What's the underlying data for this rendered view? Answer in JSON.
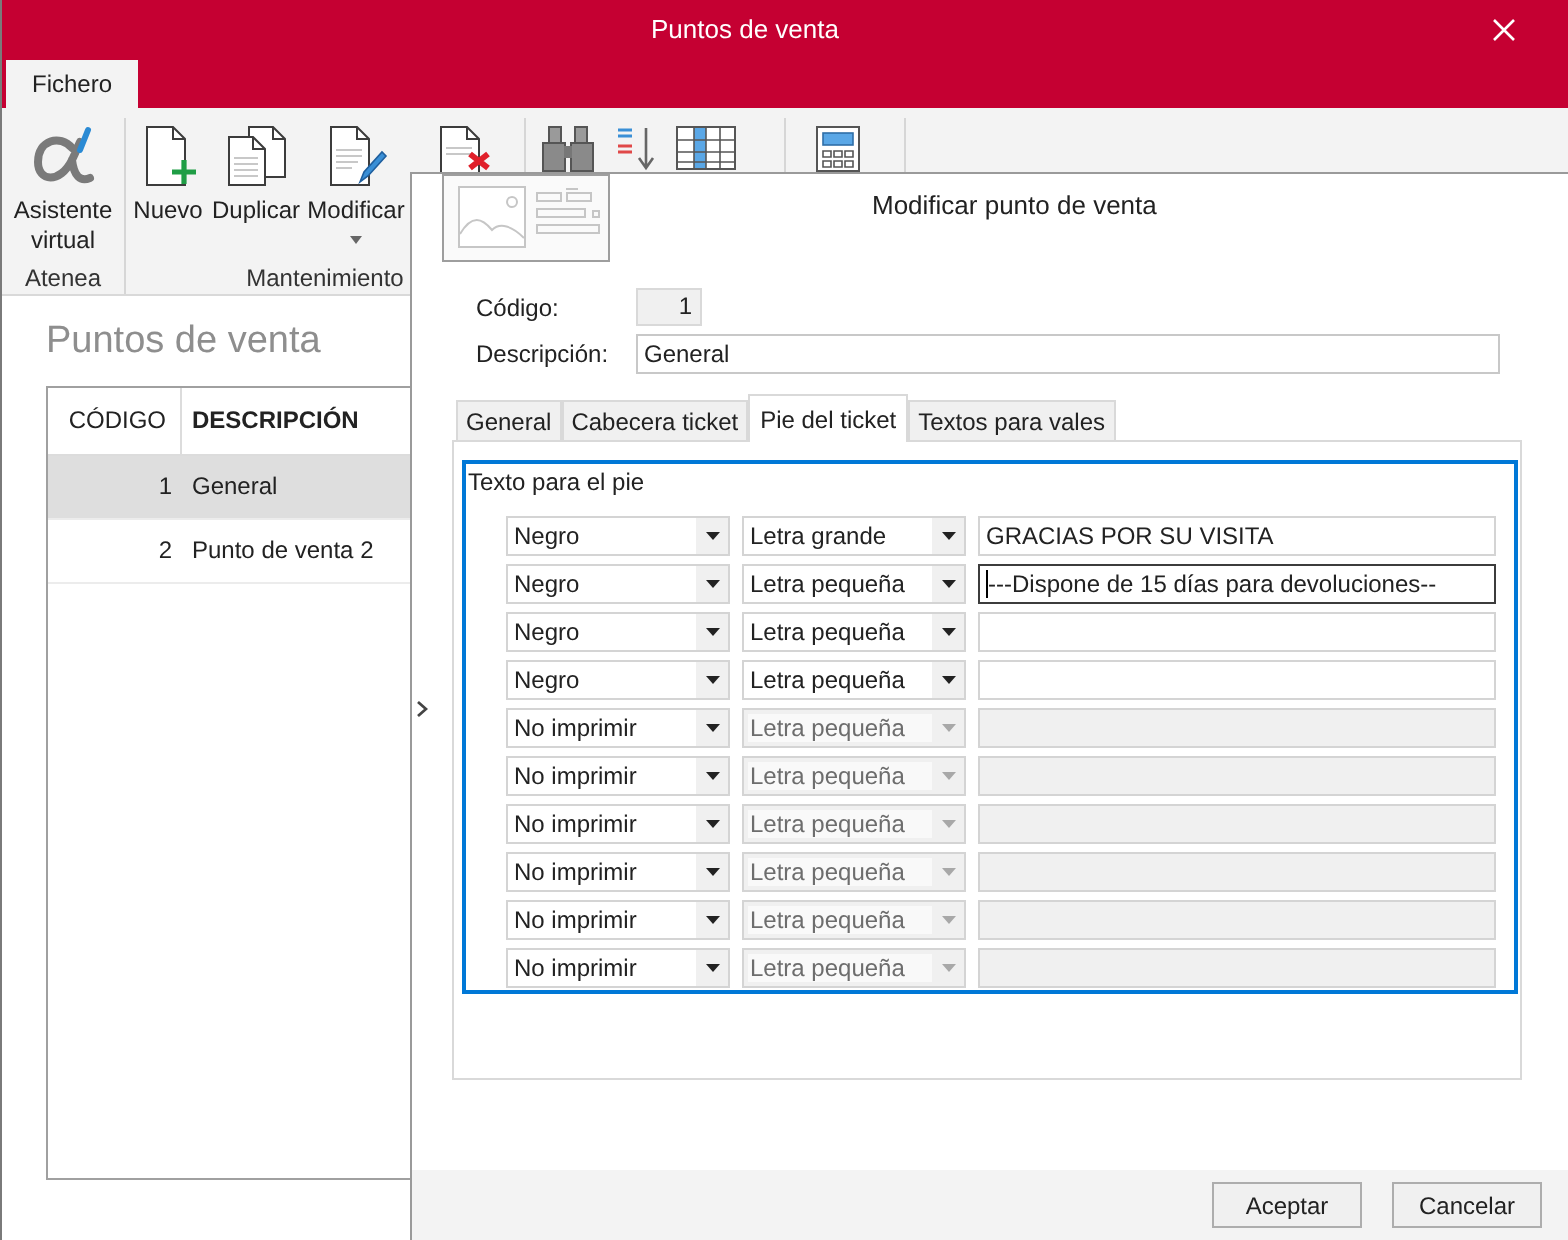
{
  "window": {
    "title": "Puntos de venta"
  },
  "ribbon": {
    "tabs": [
      {
        "label": "Fichero",
        "selected": true
      }
    ],
    "groups": [
      {
        "label": "Atenea",
        "buttons": [
          {
            "kind": "assistant",
            "label": "Asistente virtual",
            "dropdown": false
          }
        ]
      },
      {
        "label": "Mantenimiento",
        "buttons": [
          {
            "kind": "new",
            "label": "Nuevo",
            "dropdown": false
          },
          {
            "kind": "duplicate",
            "label": "Duplicar",
            "dropdown": false
          },
          {
            "kind": "edit",
            "label": "Modificar",
            "dropdown": true
          },
          {
            "kind": "delete",
            "dropdown": false
          }
        ]
      },
      {
        "buttons": [
          {
            "kind": "search",
            "dropdown": false
          },
          {
            "kind": "sort",
            "dropdown": false
          },
          {
            "kind": "columns",
            "dropdown": false
          }
        ]
      },
      {
        "buttons": [
          {
            "kind": "calculator",
            "dropdown": false
          }
        ]
      }
    ]
  },
  "list": {
    "title": "Puntos de venta",
    "columns": [
      {
        "label": "CÓDIGO",
        "sorted": false
      },
      {
        "label": "DESCRIPCIÓN",
        "sorted": true
      }
    ],
    "rows": [
      {
        "code": "1",
        "description": "General",
        "selected": true
      },
      {
        "code": "2",
        "description": "Punto de venta 2",
        "selected": false
      }
    ]
  },
  "dialog": {
    "title": "Modificar punto de venta",
    "fields": [
      {
        "kind": "number",
        "label": "Código:",
        "value": "1"
      },
      {
        "kind": "text",
        "label": "Descripción:",
        "value": "General"
      }
    ],
    "tabs": [
      {
        "label": "General",
        "selected": false
      },
      {
        "label": "Cabecera ticket",
        "selected": false
      },
      {
        "label": "Pie del ticket",
        "selected": true
      },
      {
        "label": "Textos para vales",
        "selected": false
      }
    ],
    "group": {
      "label": "Texto para el pie",
      "rows": [
        {
          "ink": "Negro",
          "size": "Letra grande",
          "text": "GRACIAS POR SU VISITA",
          "disabled": false,
          "focused": false
        },
        {
          "ink": "Negro",
          "size": "Letra pequeña",
          "text": "---Dispone de 15 días para devoluciones--",
          "disabled": false,
          "focused": true
        },
        {
          "ink": "Negro",
          "size": "Letra pequeña",
          "disabled": false,
          "focused": false
        },
        {
          "ink": "Negro",
          "size": "Letra pequeña",
          "disabled": false,
          "focused": false
        },
        {
          "ink": "No imprimir",
          "size": "Letra pequeña",
          "disabled": true,
          "focused": false
        },
        {
          "ink": "No imprimir",
          "size": "Letra pequeña",
          "disabled": true,
          "focused": false
        },
        {
          "ink": "No imprimir",
          "size": "Letra pequeña",
          "disabled": true,
          "focused": false
        },
        {
          "ink": "No imprimir",
          "size": "Letra pequeña",
          "disabled": true,
          "focused": false
        },
        {
          "ink": "No imprimir",
          "size": "Letra pequeña",
          "disabled": true,
          "focused": false
        },
        {
          "ink": "No imprimir",
          "size": "Letra pequeña",
          "disabled": true,
          "focused": false
        }
      ]
    },
    "buttons": [
      {
        "label": "Aceptar"
      },
      {
        "label": "Cancelar"
      }
    ]
  }
}
